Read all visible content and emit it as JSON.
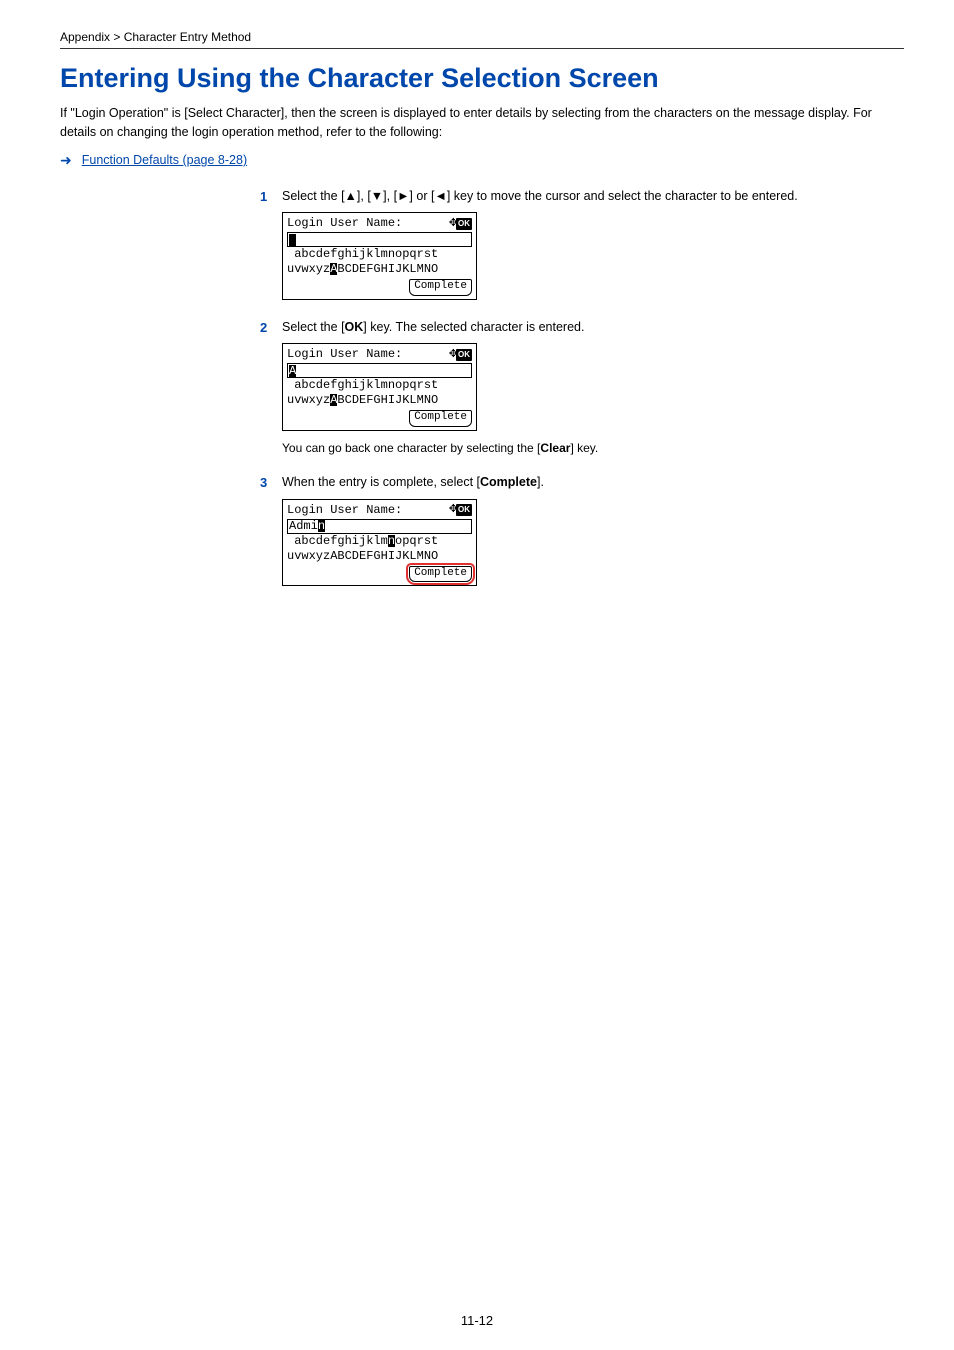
{
  "breadcrumb": "Appendix > Character Entry Method",
  "heading": "Entering Using the Character Selection Screen",
  "intro": "If \"Login Operation\" is [Select Character], then the screen is displayed to enter details by selecting from the characters on the message display. For details on changing the login operation method, refer to the following:",
  "link": "Function Defaults (page 8-28)",
  "steps": {
    "s1": {
      "num": "1",
      "text": "Select the [▲], [▼], [►] or [◄] key to move the cursor and select the character to be entered."
    },
    "s2": {
      "num": "2",
      "text_a": "Select the [",
      "text_b": "OK",
      "text_c": "] key. The selected character is entered."
    },
    "s3": {
      "num": "3",
      "text_a": "When the entry is complete, select [",
      "text_b": "Complete",
      "text_c": "]."
    }
  },
  "lcd": {
    "title": "Login User Name:",
    "complete": "Complete",
    "ok": "OK",
    "screen1": {
      "input_cursor": " ",
      "row1_a": " abcdefghijklmnopqrst",
      "row2_a": "uvwxyz",
      "row2_hl": "A",
      "row2_b": "BCDEFGHIJKLMNO"
    },
    "screen2": {
      "input_hl": "A",
      "row1_a": " abcdefghijklmnopqrst",
      "row2_a": "uvwxyz",
      "row2_hl": "A",
      "row2_b": "BCDEFGHIJKLMNO"
    },
    "screen3": {
      "input_a": "Admi",
      "input_hl": "n",
      "row1_a": " abcdefghijklm",
      "row1_hl": "n",
      "row1_b": "opqrst",
      "row2_a": "uvwxyzABCDEFGHIJKLMNO"
    }
  },
  "note": {
    "a": "You can go back one character by selecting the [",
    "b": "Clear",
    "c": "] key."
  },
  "page_num": "11-12"
}
